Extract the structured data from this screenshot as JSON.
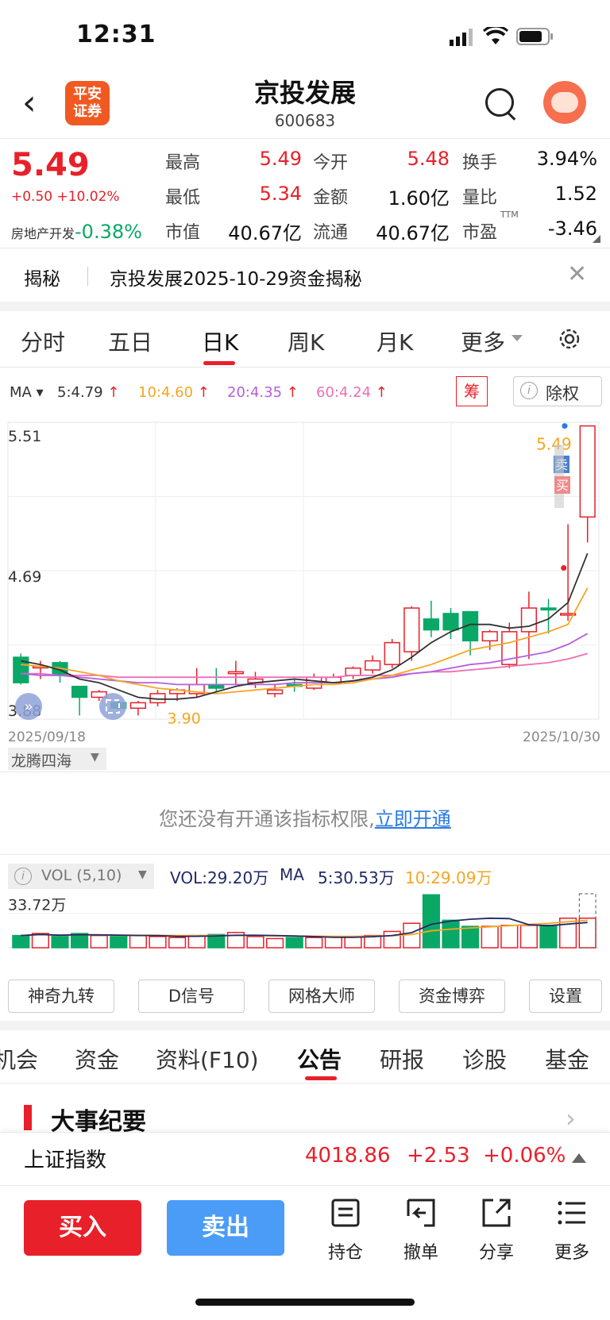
{
  "status": {
    "time": "12:31"
  },
  "nav": {
    "logo_line1": "平安",
    "logo_line2": "证券",
    "title": "京投发展",
    "code": "600683"
  },
  "quote": {
    "price": "5.49",
    "change": "+0.50 +10.02%",
    "sector_name": "房地产开发",
    "sector_change": "-0.38%",
    "high_label": "最高",
    "high": "5.49",
    "open_label": "今开",
    "open": "5.48",
    "turnover_label": "换手",
    "turnover": "3.94%",
    "low_label": "最低",
    "low": "5.34",
    "amount_label": "金额",
    "amount": "1.60亿",
    "vol_ratio_label": "量比",
    "vol_ratio": "1.52",
    "mktcap_label": "市值",
    "mktcap": "40.67亿",
    "float_label": "流通",
    "float": "40.67亿",
    "pe_label": "市盈",
    "pe_sup": "TTM",
    "pe": "-3.46"
  },
  "reveal": {
    "tag": "揭秘",
    "text": "京投发展2025-10-29资金揭秘"
  },
  "ktabs": [
    "分时",
    "五日",
    "日K",
    "周K",
    "月K",
    "更多"
  ],
  "ma": {
    "label": "MA",
    "ma5": "5:4.79",
    "ma10": "10:4.60",
    "ma20": "20:4.35",
    "ma60": "60:4.24",
    "chip": "筹",
    "fq": "除权"
  },
  "chart": {
    "y_top": "5.51",
    "y_mid": "4.69",
    "y_bottom": "3.88",
    "low_mark": "3.90",
    "last_mark": "5.49",
    "date_start": "2025/09/18",
    "date_end": "2025/10/30",
    "buy": "买",
    "sell": "卖",
    "colors": {
      "up": "#e8202a",
      "down": "#0aa867",
      "ma5": "#333333",
      "ma10": "#f5a623",
      "ma20": "#b45fe0",
      "ma60": "#ee6fb5"
    }
  },
  "chart_data": {
    "type": "candlestick",
    "x": [
      "2025/09/18",
      "",
      "",
      "",
      "",
      "",
      "",
      "",
      "",
      "",
      "",
      "",
      "",
      "",
      "",
      "",
      "",
      "",
      "",
      "",
      "",
      "",
      "",
      "",
      "",
      "",
      "",
      "",
      "",
      "2025/10/30"
    ],
    "open": [
      4.22,
      4.17,
      4.19,
      4.06,
      4.0,
      3.97,
      3.94,
      3.97,
      4.02,
      4.02,
      4.07,
      4.13,
      4.08,
      4.02,
      4.07,
      4.05,
      4.08,
      4.12,
      4.15,
      4.18,
      4.25,
      4.43,
      4.46,
      4.47,
      4.31,
      4.18,
      4.36,
      4.49,
      4.46,
      4.99
    ],
    "close": [
      4.08,
      4.17,
      4.12,
      4.0,
      4.03,
      3.94,
      3.97,
      4.02,
      4.04,
      4.07,
      4.05,
      4.14,
      4.1,
      4.04,
      4.06,
      4.11,
      4.11,
      4.16,
      4.2,
      4.3,
      4.49,
      4.37,
      4.37,
      4.31,
      4.36,
      4.36,
      4.49,
      4.48,
      4.46,
      5.49
    ],
    "high": [
      4.24,
      4.2,
      4.2,
      4.06,
      4.04,
      3.99,
      3.98,
      4.04,
      4.05,
      4.16,
      4.16,
      4.2,
      4.14,
      4.07,
      4.1,
      4.13,
      4.13,
      4.17,
      4.23,
      4.32,
      4.5,
      4.53,
      4.49,
      4.47,
      4.37,
      4.41,
      4.58,
      4.54,
      4.95,
      5.49
    ],
    "low": [
      4.07,
      4.1,
      4.08,
      3.9,
      3.98,
      3.93,
      3.9,
      3.95,
      3.98,
      4.0,
      4.03,
      4.07,
      4.05,
      4.0,
      4.03,
      4.04,
      4.08,
      4.1,
      4.13,
      4.16,
      4.2,
      4.33,
      4.32,
      4.23,
      4.26,
      4.16,
      4.21,
      4.35,
      4.42,
      4.85
    ],
    "ma5": [
      4.2,
      4.18,
      4.15,
      4.1,
      4.08,
      4.04,
      4.0,
      3.99,
      3.99,
      4.0,
      4.03,
      4.06,
      4.08,
      4.09,
      4.1,
      4.09,
      4.08,
      4.09,
      4.11,
      4.15,
      4.22,
      4.3,
      4.36,
      4.4,
      4.4,
      4.38,
      4.39,
      4.43,
      4.52,
      4.79
    ],
    "ma10": [
      4.18,
      4.17,
      4.16,
      4.14,
      4.12,
      4.09,
      4.07,
      4.05,
      4.04,
      4.03,
      4.02,
      4.03,
      4.04,
      4.05,
      4.06,
      4.07,
      4.07,
      4.08,
      4.1,
      4.12,
      4.15,
      4.18,
      4.22,
      4.26,
      4.28,
      4.3,
      4.33,
      4.36,
      4.4,
      4.6
    ],
    "ma20": [
      4.13,
      4.12,
      4.12,
      4.11,
      4.1,
      4.09,
      4.08,
      4.08,
      4.07,
      4.07,
      4.07,
      4.07,
      4.07,
      4.07,
      4.08,
      4.08,
      4.08,
      4.09,
      4.1,
      4.11,
      4.13,
      4.14,
      4.16,
      4.18,
      4.19,
      4.21,
      4.23,
      4.25,
      4.29,
      4.35
    ],
    "ma60": [
      4.13,
      4.13,
      4.12,
      4.12,
      4.12,
      4.11,
      4.11,
      4.11,
      4.11,
      4.11,
      4.11,
      4.11,
      4.11,
      4.11,
      4.11,
      4.11,
      4.11,
      4.12,
      4.12,
      4.12,
      4.13,
      4.14,
      4.14,
      4.15,
      4.16,
      4.17,
      4.18,
      4.19,
      4.21,
      4.24
    ],
    "vol": [
      12,
      14,
      11,
      14,
      12,
      11,
      12,
      11,
      10,
      12,
      13,
      15,
      11,
      9,
      10,
      10,
      11,
      11,
      12,
      16,
      24,
      52,
      27,
      21,
      21,
      22,
      22,
      22,
      29,
      29
    ],
    "ylim": [
      3.88,
      5.51
    ],
    "vol_ylim": [
      0,
      53
    ]
  },
  "indicator": {
    "name": "龙腾四海",
    "msg": "您还没有开通该指标权限,",
    "link": "立即开通"
  },
  "vol": {
    "label": "VOL (5,10)",
    "vol": "VOL:29.20万",
    "ma": "MA",
    "ma5": "5:30.53万",
    "ma10": "10:29.09万",
    "axis": "33.72万"
  },
  "ind_buttons": [
    "神奇九转",
    "D信号",
    "网格大师",
    "资金博弈",
    "设置"
  ],
  "btabs": [
    "机会",
    "资金",
    "资料(F10)",
    "公告",
    "研报",
    "诊股",
    "基金"
  ],
  "section": {
    "title": "大事纪要"
  },
  "index": {
    "name": "上证指数",
    "value": "4018.86",
    "change": "+2.53",
    "pct": "+0.06%"
  },
  "actions": {
    "buy": "买入",
    "sell": "卖出",
    "hold": "持仓",
    "cancel": "撤单",
    "share": "分享",
    "more": "更多"
  }
}
